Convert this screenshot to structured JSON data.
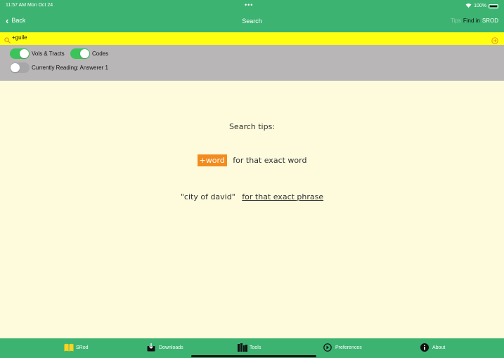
{
  "status_bar": {
    "time": "11:57 AM  Mon Oct 24",
    "dots": "•••",
    "battery": "100%"
  },
  "nav": {
    "back_label": "Back",
    "title": "Search",
    "tips_label": "Tips",
    "findin_label": "Find in",
    "srod_label": "SROD"
  },
  "search": {
    "value": "+guile"
  },
  "options": {
    "vols_tracts": {
      "label": "Vols & Tracts",
      "on": true
    },
    "codes": {
      "label": "Codes",
      "on": true
    },
    "currently_reading": {
      "label": "Currently Reading: Answerer 1",
      "on": false
    }
  },
  "content": {
    "heading": "Search tips:",
    "tip1": {
      "highlight": "+word",
      "text": "for that exact word"
    },
    "tip2": {
      "quote": "\"city of david\"",
      "text": "for that exact phrase"
    }
  },
  "tabs": [
    {
      "label": "SRod",
      "icon": "book-icon"
    },
    {
      "label": "Downloads",
      "icon": "download-icon"
    },
    {
      "label": "Tools",
      "icon": "library-icon"
    },
    {
      "label": "Preferences",
      "icon": "preferences-icon"
    },
    {
      "label": "About",
      "icon": "info-icon"
    }
  ],
  "colors": {
    "primary_green": "#3cb371",
    "search_yellow": "#ffff10",
    "options_gray": "#b8b6b7",
    "content_bg": "#fdfbdc",
    "highlight_orange": "#f28c1e",
    "toggle_on": "#3cc35a"
  }
}
